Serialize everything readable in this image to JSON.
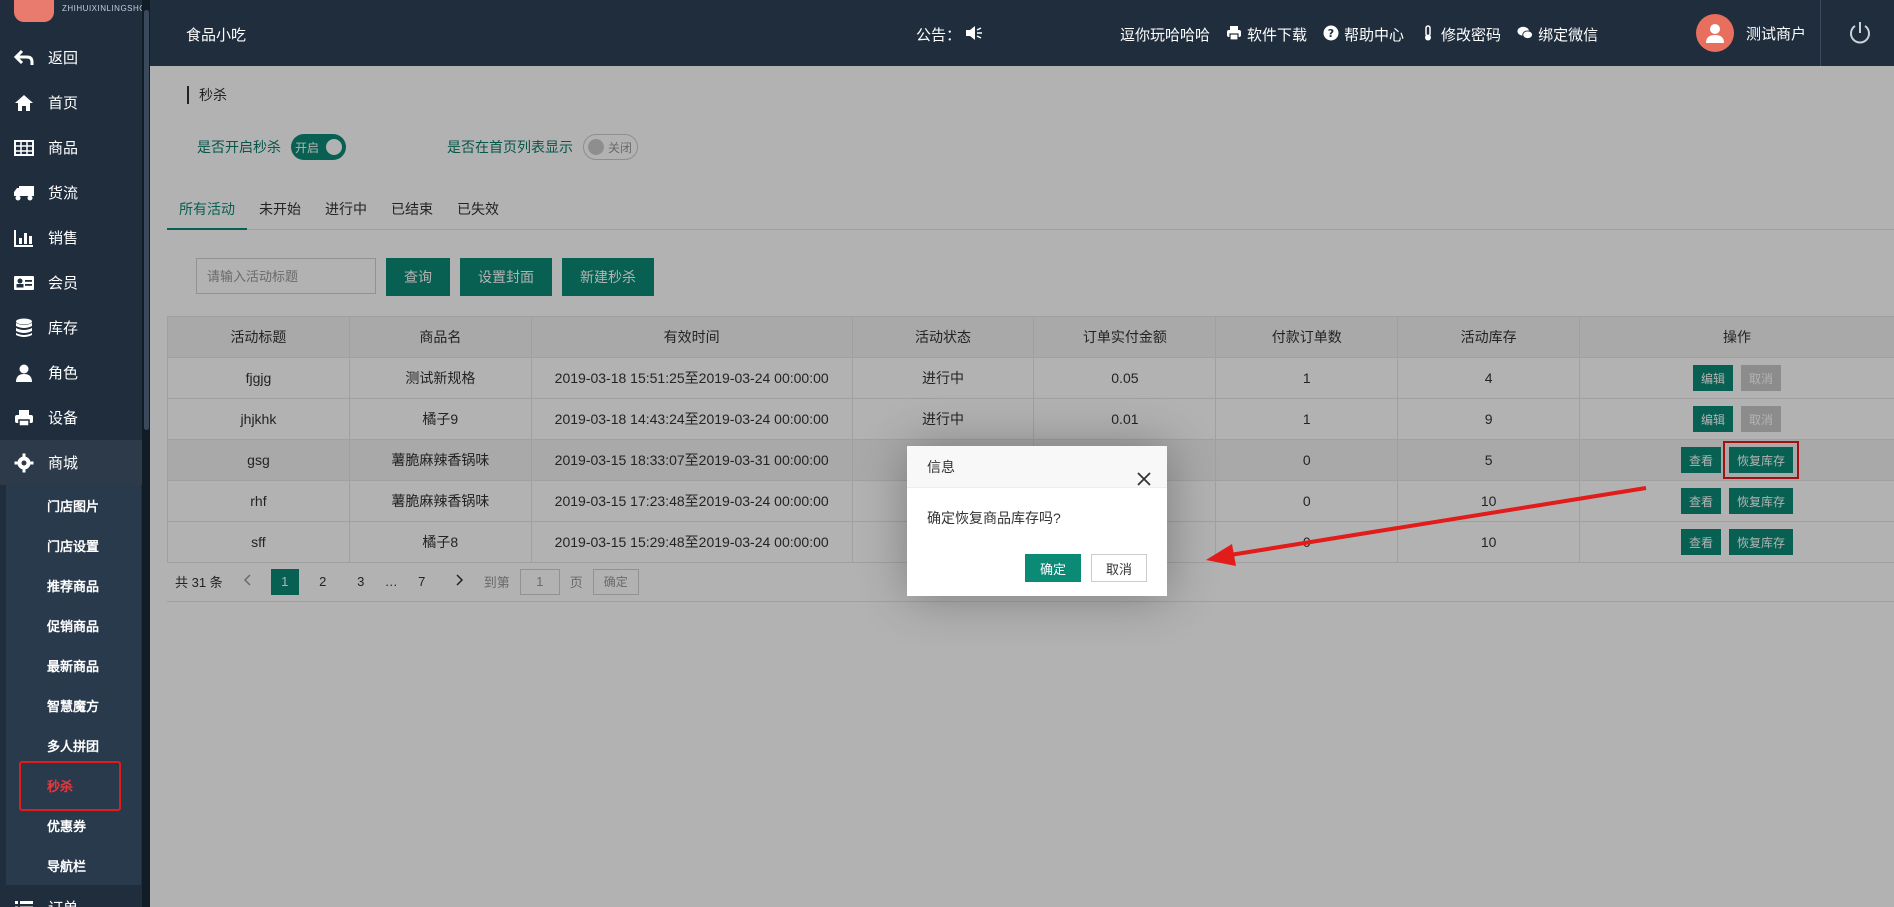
{
  "brand": {
    "logo_caption": "ZHIHUIXINLINGSHOU"
  },
  "sidebar": {
    "items": [
      {
        "label": "返回",
        "icon": "back-arrow-icon"
      },
      {
        "label": "首页",
        "icon": "home-icon"
      },
      {
        "label": "商品",
        "icon": "table-icon"
      },
      {
        "label": "货流",
        "icon": "truck-icon"
      },
      {
        "label": "销售",
        "icon": "bar-chart-icon"
      },
      {
        "label": "会员",
        "icon": "id-card-icon"
      },
      {
        "label": "库存",
        "icon": "database-icon"
      },
      {
        "label": "角色",
        "icon": "user-icon"
      },
      {
        "label": "设备",
        "icon": "printer-icon"
      },
      {
        "label": "商城",
        "icon": "gear-icon"
      }
    ],
    "submenu": [
      "门店图片",
      "门店设置",
      "推荐商品",
      "促销商品",
      "最新商品",
      "智慧魔方",
      "多人拼团",
      "秒杀",
      "优惠券",
      "导航栏"
    ],
    "active_sub": "秒杀",
    "next_item": "订单"
  },
  "topbar": {
    "title": "食品小吃",
    "notice_label": "公告：",
    "notice_scroll": "逗你玩哈哈哈",
    "links": [
      {
        "label": "软件下载",
        "icon": "printer-icon"
      },
      {
        "label": "帮助中心",
        "icon": "question-circle-icon"
      },
      {
        "label": "修改密码",
        "icon": "thermometer-icon"
      },
      {
        "label": "绑定微信",
        "icon": "wechat-icon"
      }
    ],
    "user_name": "测试商户"
  },
  "page": {
    "breadcrumb": "秒杀",
    "toggle_enable_label": "是否开启秒杀",
    "toggle_enable_state": "开启",
    "toggle_home_label": "是否在首页列表显示",
    "toggle_home_state": "关闭",
    "tabs": [
      "所有活动",
      "未开始",
      "进行中",
      "已结束",
      "已失效"
    ],
    "search_placeholder": "请输入活动标题",
    "buttons": {
      "query": "查询",
      "cover": "设置封面",
      "create": "新建秒杀"
    }
  },
  "table": {
    "headers": [
      "活动标题",
      "商品名",
      "有效时间",
      "活动状态",
      "订单实付金额",
      "付款订单数",
      "活动库存",
      "操作"
    ],
    "rows": [
      {
        "title": "fjgjg",
        "product": "测试新规格",
        "time": "2019-03-18 15:51:25至2019-03-24 00:00:00",
        "status": "进行中",
        "amount": "0.05",
        "orders": "1",
        "stock": "4",
        "btn1": "编辑",
        "btn2": "取消"
      },
      {
        "title": "jhjkhk",
        "product": "橘子9",
        "time": "2019-03-18 14:43:24至2019-03-24 00:00:00",
        "status": "进行中",
        "amount": "0.01",
        "orders": "1",
        "stock": "9",
        "btn1": "编辑",
        "btn2": "取消"
      },
      {
        "title": "gsg",
        "product": "薯脆麻辣香锅味",
        "time": "2019-03-15 18:33:07至2019-03-31 00:00:00",
        "status": "",
        "amount": "",
        "orders": "0",
        "stock": "5",
        "btn1": "查看",
        "btn2": "恢复库存"
      },
      {
        "title": "rhf",
        "product": "薯脆麻辣香锅味",
        "time": "2019-03-15 17:23:48至2019-03-24 00:00:00",
        "status": "",
        "amount": "",
        "orders": "0",
        "stock": "10",
        "btn1": "查看",
        "btn2": "恢复库存"
      },
      {
        "title": "sff",
        "product": "橘子8",
        "time": "2019-03-15 15:29:48至2019-03-24 00:00:00",
        "status": "",
        "amount": "",
        "orders": "0",
        "stock": "10",
        "btn1": "查看",
        "btn2": "恢复库存"
      }
    ]
  },
  "pager": {
    "total": "共 31 条",
    "pages": [
      "1",
      "2",
      "3",
      "…",
      "7"
    ],
    "current": "1",
    "goto_label": "到第",
    "goto_value": "1",
    "page_label": "页",
    "confirm": "确定"
  },
  "dialog": {
    "title": "信息",
    "message": "确定恢复商品库存吗?",
    "ok": "确定",
    "cancel": "取消"
  },
  "colors": {
    "sidebar_bg": "#1f2d3d",
    "primary": "#0b8a76",
    "annotation_red": "#e21b1b"
  }
}
